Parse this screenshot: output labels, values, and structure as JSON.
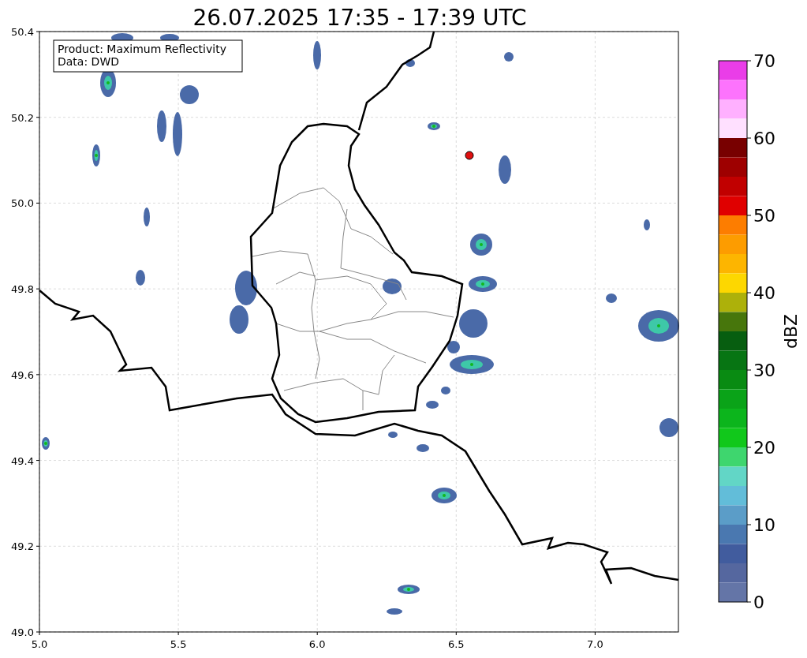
{
  "title": "26.07.2025 17:35 - 17:39 UTC",
  "legend": [
    "Product: Maximum Reflectivity",
    "Data: DWD"
  ],
  "y_axis": {
    "ticks": [
      "50.4",
      "50.2",
      "50.0",
      "49.8",
      "49.6",
      "49.4",
      "49.2",
      "49.0"
    ]
  },
  "x_axis": {
    "ticks": [
      "5.0",
      "5.5",
      "6.0",
      "6.5",
      "7.0"
    ]
  },
  "colorbar": {
    "label": "dBZ",
    "ticks": [
      "70",
      "60",
      "50",
      "40",
      "30",
      "20",
      "10",
      "0"
    ],
    "bins": [
      {
        "color": "#ea3de8"
      },
      {
        "color": "#fd73fd"
      },
      {
        "color": "#ffb0ff"
      },
      {
        "color": "#ffe0ff"
      },
      {
        "color": "#780000"
      },
      {
        "color": "#9e0000"
      },
      {
        "color": "#c10000"
      },
      {
        "color": "#e00000"
      },
      {
        "color": "#fd7d00"
      },
      {
        "color": "#fd9c00"
      },
      {
        "color": "#fdb500"
      },
      {
        "color": "#fdd700"
      },
      {
        "color": "#adb10a"
      },
      {
        "color": "#47760c"
      },
      {
        "color": "#075e10"
      },
      {
        "color": "#077513"
      },
      {
        "color": "#098b12"
      },
      {
        "color": "#0aa318"
      },
      {
        "color": "#0cb51c"
      },
      {
        "color": "#11c81b"
      },
      {
        "color": "#3ed66e"
      },
      {
        "color": "#62d6c6"
      },
      {
        "color": "#62bdd9"
      },
      {
        "color": "#5b9dc8"
      },
      {
        "color": "#4a78b0"
      },
      {
        "color": "#415c9e"
      },
      {
        "color": "#55679f"
      },
      {
        "color": "#6475a7"
      }
    ]
  }
}
